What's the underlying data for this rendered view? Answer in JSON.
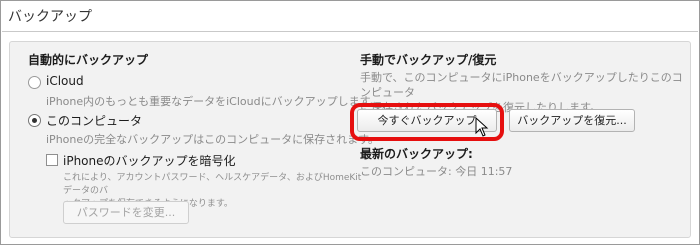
{
  "section": {
    "title": "バックアップ"
  },
  "auto_backup": {
    "heading": "自動的にバックアップ",
    "icloud": {
      "label": "iCloud",
      "description": "iPhone内のもっとも重要なデータをiCloudにバックアップします。",
      "selected": false
    },
    "this_computer": {
      "label": "このコンピュータ",
      "description": "iPhoneの完全なバックアップはこのコンピュータに保存されます。",
      "selected": true
    },
    "encrypt": {
      "label": "iPhoneのバックアップを暗号化",
      "checked": false,
      "note_line1": "これにより、アカウントパスワード、ヘルスケアデータ、およびHomeKitデータのバ",
      "note_line2": "ックアップを保存できるようになります。"
    },
    "change_password_label": "パスワードを変更..."
  },
  "manual_backup": {
    "heading": "手動でバックアップ/復元",
    "description_line1": "手動で、このコンピュータにiPhoneをバックアップしたりこのコンピュータ",
    "description_line2": "に保存されたバックアップを復元したりします。",
    "backup_now_label": "今すぐバックアップ",
    "restore_label": "バックアップを復元...",
    "latest_heading": "最新のバックアップ:",
    "latest_value": "このコンピュータ: 今日 11:57"
  },
  "icons": [
    "radio-button-icon",
    "checkbox-icon",
    "mouse-pointer-icon"
  ],
  "colors": {
    "highlight": "#e60f0f",
    "panel_bg": "#f2f2f2",
    "muted_text": "#8a8a8a"
  }
}
